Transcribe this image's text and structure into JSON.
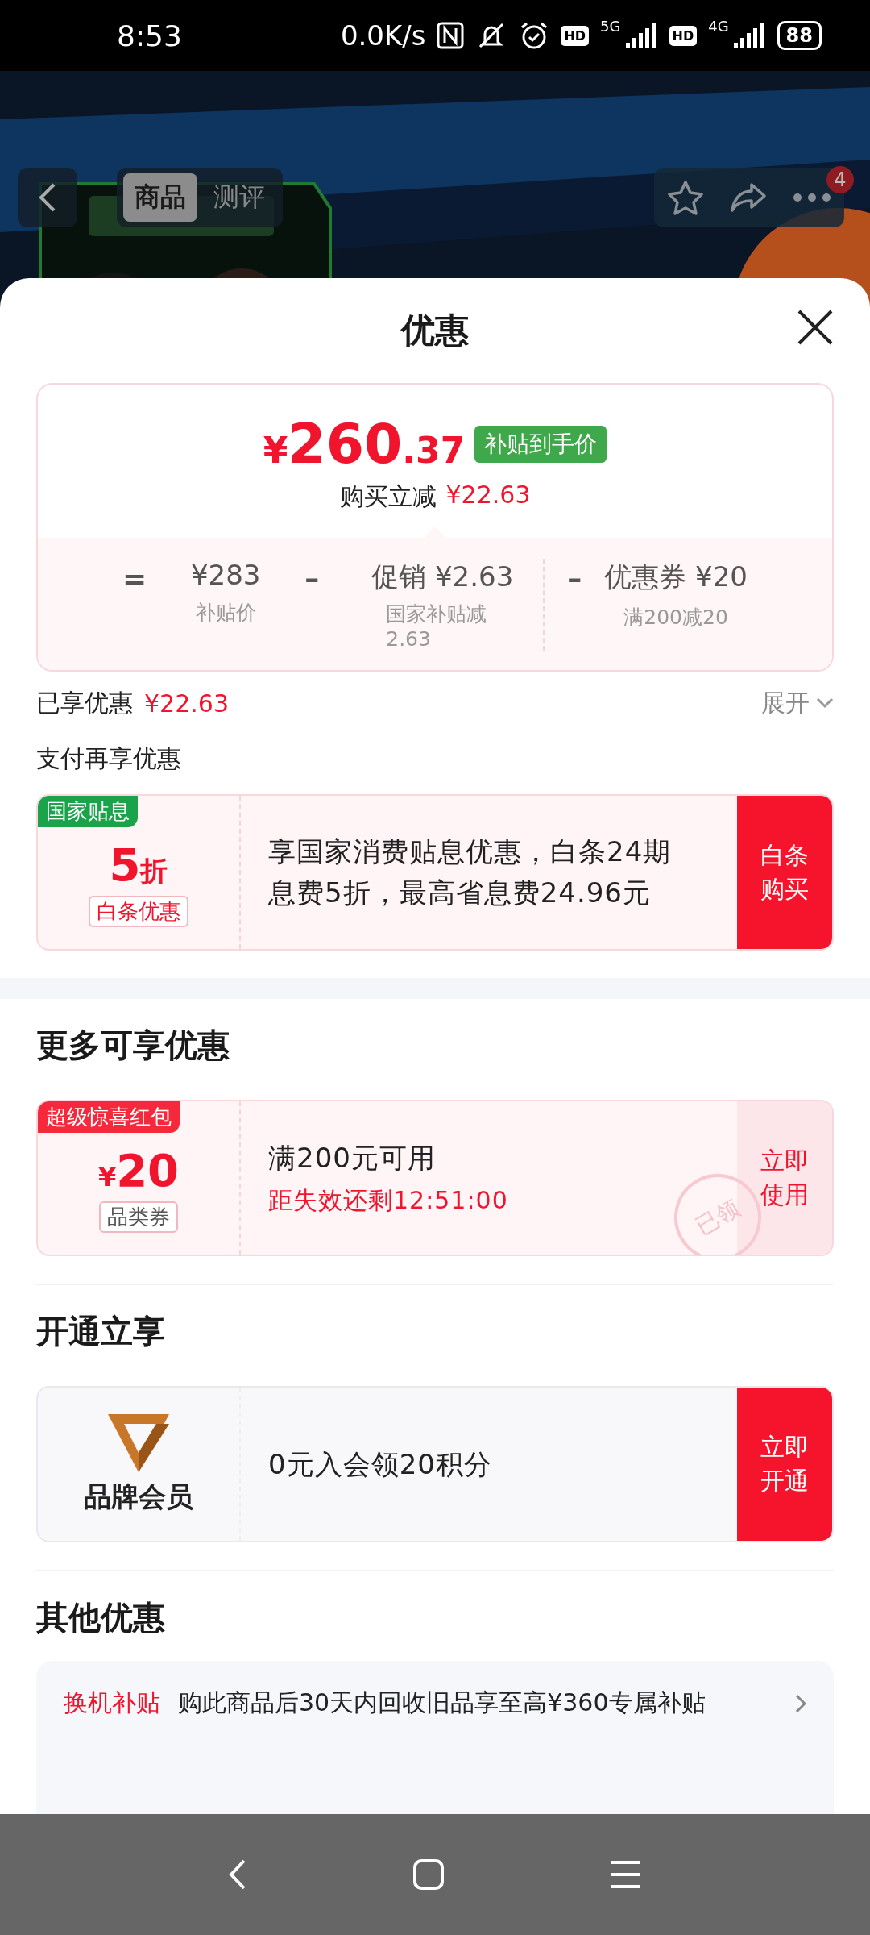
{
  "status_bar": {
    "time": "8:53",
    "net_speed": "0.0K/s",
    "sims": [
      {
        "hd": "HD",
        "network": "5G"
      },
      {
        "hd": "HD",
        "network": "4G"
      }
    ],
    "battery": "88"
  },
  "header": {
    "tabs": [
      {
        "label": "商品",
        "selected": true
      },
      {
        "label": "测评",
        "selected": false
      }
    ],
    "badge": "4"
  },
  "sheet": {
    "title": "优惠",
    "price": {
      "currency": "¥",
      "integer": "260",
      "decimal": ".37",
      "tag": "补贴到手价",
      "reduce_label": "购买立减",
      "reduce_amount": "¥22.63",
      "equals": "=",
      "terms": [
        {
          "main": "¥283",
          "note": "补贴价"
        },
        {
          "op": "–",
          "main": "促销 ¥2.63",
          "note": "国家补贴减2.63"
        },
        {
          "op": "–",
          "main": "优惠券 ¥20",
          "note": "满200减20"
        }
      ]
    },
    "enjoyed": {
      "label": "已享优惠",
      "amount": "¥22.63",
      "expand": "展开"
    },
    "sections": [
      {
        "heading": "支付再享优惠",
        "kind": "small",
        "cards": [
          {
            "kind": "discount",
            "corner_tag": {
              "label": "国家贴息",
              "color": "#1aa34a"
            },
            "value": "5",
            "unit": "折",
            "label": "白条优惠",
            "lines": [
              "享国家消费贴息优惠，白条24期息费5折，最高省息费24.96元"
            ],
            "action": {
              "label": "白条购买",
              "kind": "solid"
            }
          }
        ]
      },
      {
        "heading": "更多可享优惠",
        "kind": "large",
        "cards": [
          {
            "kind": "cash",
            "corner_tag": {
              "label": "超级惊喜红包",
              "color": "#f5283c"
            },
            "currency": "¥",
            "value": "20",
            "label": "品类券",
            "lines": [
              "满200元可用",
              "距失效还剩12:51:00"
            ],
            "action": {
              "label": "立即使用",
              "kind": "soft"
            },
            "stamp": "已领"
          }
        ]
      },
      {
        "heading": "开通立享",
        "kind": "large",
        "cards": [
          {
            "kind": "member",
            "label": "品牌会员",
            "lines": [
              "0元入会领20积分"
            ],
            "action": {
              "label": "立即开通",
              "kind": "solid"
            }
          }
        ]
      }
    ],
    "other": {
      "heading": "其他优惠",
      "items": [
        {
          "tag": "换机补贴",
          "text": "购此商品后30天内回收旧品享至高¥360专属补贴"
        }
      ]
    }
  }
}
